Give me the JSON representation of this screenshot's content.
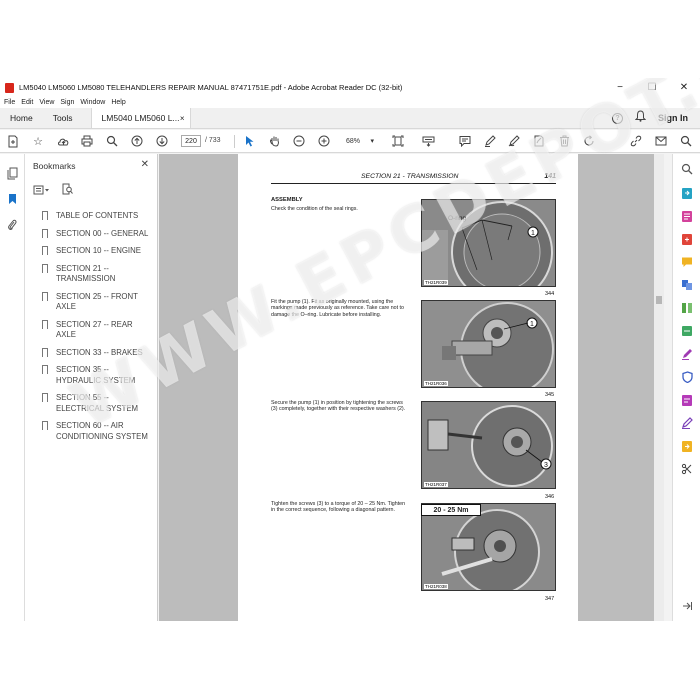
{
  "window": {
    "title": "LM5040 LM5060 LM5080 TELEHANDLERS REPAIR MANUAL 87471751E.pdf - Adobe Acrobat Reader DC (32-bit)",
    "controls": {
      "minimize": "−",
      "maximize": "☐",
      "close": "✕"
    }
  },
  "menu": [
    "File",
    "Edit",
    "View",
    "Sign",
    "Window",
    "Help"
  ],
  "tabs": {
    "home": "Home",
    "tools": "Tools",
    "document": "LM5040 LM5060 L...",
    "doc_close": "×",
    "sign_in": "Sign In",
    "help": "?"
  },
  "toolbar": {
    "page_current": "220",
    "page_total": "/ 733",
    "zoom": "68%",
    "zoom_arrow": "▾"
  },
  "bookmarks": {
    "title": "Bookmarks",
    "close": "✕",
    "items": [
      "TABLE OF CONTENTS",
      "SECTION 00 -- GENERAL",
      "SECTION 10 -- ENGINE",
      "SECTION 21 -- TRANSMISSION",
      "SECTION 25 -- FRONT AXLE",
      "SECTION 27 -- REAR AXLE",
      "SECTION 33 -- BRAKES",
      "SECTION 35 -- HYDRAULIC SYSTEM",
      "SECTION 55 -- ELECTRICAL SYSTEM",
      "SECTION 60 -- AIR CONDITIONING SYSTEM"
    ]
  },
  "page": {
    "section_title": "SECTION 21 - TRANSMISSION",
    "page_number": "141",
    "heading": "ASSEMBLY",
    "steps": [
      "Check the condition of the seal rings.",
      "Fit the pump (1). Fit as originally mounted, using the markings made previously as reference. Take care not to damage the O–ring. Lubricate before installing.",
      "Secure the pump (1) in position by tightening the screws (3) completely, together with their respective washers (2).",
      "Tighten the screws (3) to a torque of 20 – 25 Nm. Tighten in the correct sequence, following a diagonal pattern."
    ],
    "figures": [
      {
        "number": "344",
        "ref": "TH21R039",
        "callout": "1",
        "label": "O-ring"
      },
      {
        "number": "345",
        "ref": "TH21R036",
        "callout": "1"
      },
      {
        "number": "346",
        "ref": "TH21R037",
        "callout": "3"
      },
      {
        "number": "347",
        "ref": "TH21R038",
        "torque": "20 - 25 Nm"
      }
    ]
  },
  "watermark": "WWW.EPCDEPOT.COM",
  "colors": {
    "accent": "#d7261b",
    "doc_background": "#bcbcbc",
    "tool_blue": "#1a73c9"
  }
}
